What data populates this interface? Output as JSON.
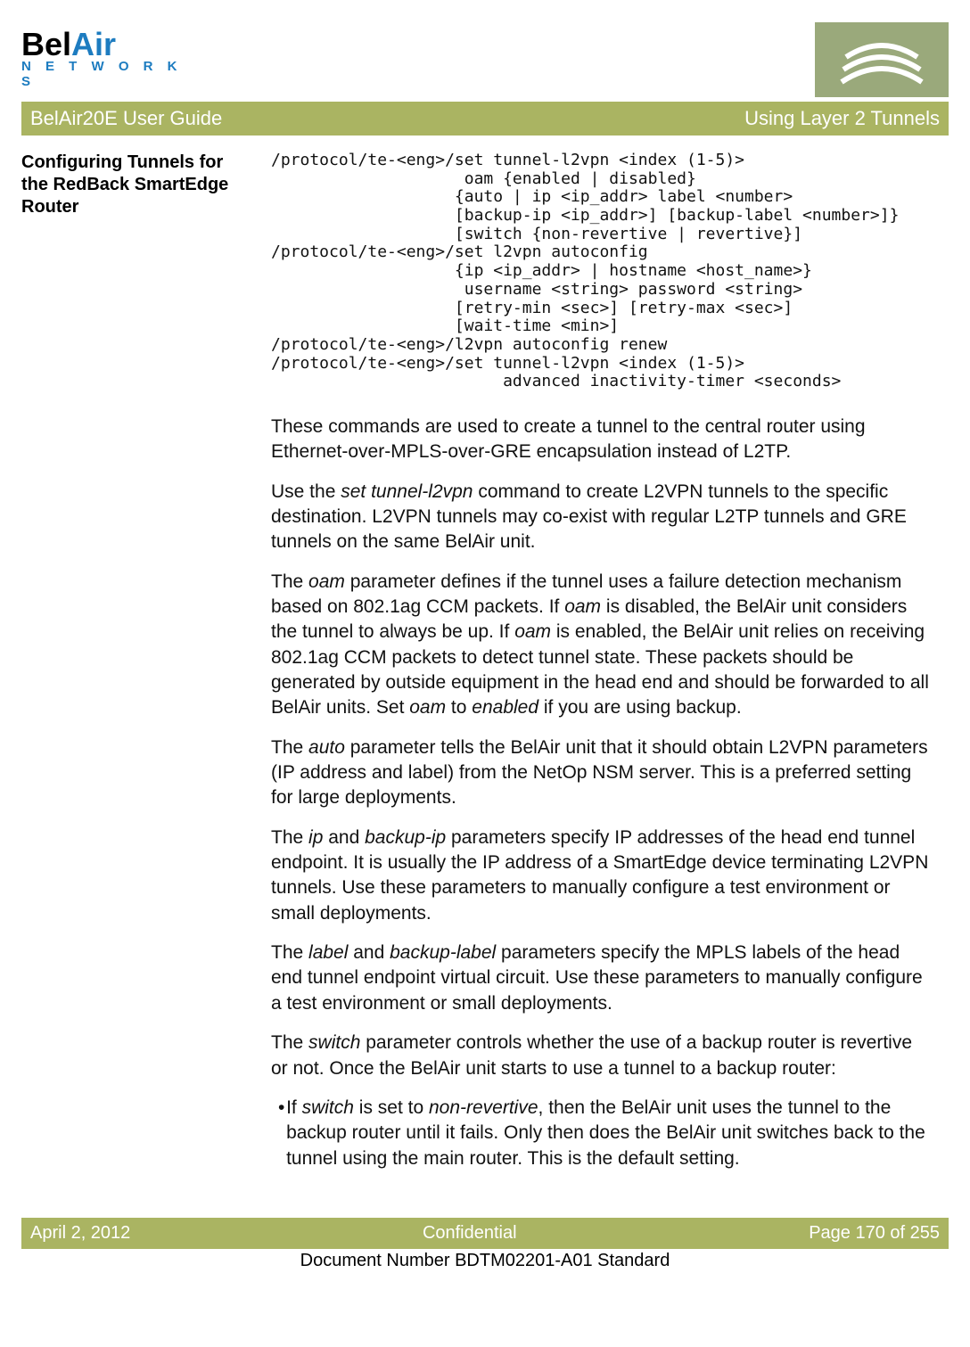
{
  "logo": {
    "name": "BelAir",
    "sub": "N E T W O R K S"
  },
  "header": {
    "left": "BelAir20E User Guide",
    "right": "Using Layer 2 Tunnels"
  },
  "side_heading": "Configuring Tunnels for the RedBack SmartEdge Router",
  "code": "/protocol/te-<eng>/set tunnel-l2vpn <index (1-5)>\n                    oam {enabled | disabled}\n                   {auto | ip <ip_addr> label <number>\n                   [backup-ip <ip_addr>] [backup-label <number>]}\n                   [switch {non-revertive | revertive}]\n/protocol/te-<eng>/set l2vpn autoconfig\n                   {ip <ip_addr> | hostname <host_name>}\n                    username <string> password <string>\n                   [retry-min <sec>] [retry-max <sec>]\n                   [wait-time <min>]\n/protocol/te-<eng>/l2vpn autoconfig renew\n/protocol/te-<eng>/set tunnel-l2vpn <index (1-5)>\n                        advanced inactivity-timer <seconds>",
  "p1": "These commands are used to create a tunnel to the central router using Ethernet-over-MPLS-over-GRE encapsulation instead of L2TP.",
  "p2a": "Use the ",
  "p2i": "set tunnel-l2vpn",
  "p2b": " command to create L2VPN tunnels to the specific destination. L2VPN tunnels may co-exist with regular L2TP tunnels and GRE tunnels on the same BelAir unit.",
  "p3a": "The ",
  "p3i1": "oam",
  "p3b": " parameter defines if the tunnel uses a failure detection mechanism based on 802.1ag CCM packets. If ",
  "p3i2": "oam",
  "p3c": " is disabled, the BelAir unit considers the tunnel to always be up. If ",
  "p3i3": "oam",
  "p3d": " is enabled, the BelAir unit relies on receiving 802.1ag CCM packets to detect tunnel state. These packets should be generated by outside equipment in the head end and should be forwarded to all BelAir units. Set ",
  "p3i4": "oam",
  "p3e": " to ",
  "p3i5": "enabled",
  "p3f": " if you are using backup.",
  "p4a": "The ",
  "p4i": "auto",
  "p4b": " parameter tells the BelAir unit that it should obtain L2VPN parameters (IP address and label) from the NetOp NSM server. This is a preferred setting for large deployments.",
  "p5a": "The ",
  "p5i1": "ip",
  "p5b": " and ",
  "p5i2": "backup-ip",
  "p5c": " parameters specify IP addresses of the head end tunnel endpoint. It is usually the IP address of a SmartEdge device terminating L2VPN tunnels. Use these parameters to manually configure a test environment or small deployments.",
  "p6a": "The ",
  "p6i1": "label",
  "p6b": " and ",
  "p6i2": "backup-label",
  "p6c": " parameters specify the MPLS labels of the head end tunnel endpoint virtual circuit. Use these parameters to manually configure a test environment or small deployments.",
  "p7a": "The ",
  "p7i": "switch",
  "p7b": " parameter controls whether the use of a backup router is revertive or not. Once the BelAir unit starts to use a tunnel to a backup router:",
  "b1a": "If ",
  "b1i1": "switch",
  "b1b": " is set to ",
  "b1i2": "non-revertive",
  "b1c": ", then the BelAir unit uses the tunnel to the backup router until it fails. Only then does the BelAir unit switches back to the tunnel using the main router. This is the default setting.",
  "footer": {
    "left": "April 2, 2012",
    "center": "Confidential",
    "right": "Page 170 of 255"
  },
  "docnum": "Document Number BDTM02201-A01 Standard"
}
